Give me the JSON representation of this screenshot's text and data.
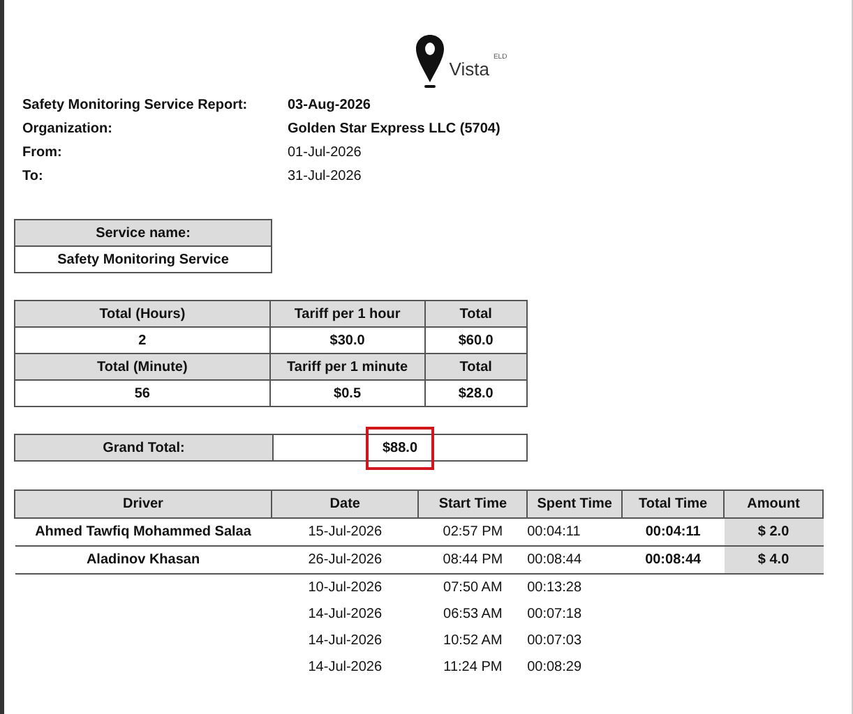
{
  "logo": {
    "text": "Vista",
    "superscript": "ELD"
  },
  "info": [
    {
      "label": "Safety Monitoring Service Report:",
      "value": "03-Aug-2026",
      "bold": true
    },
    {
      "label": "Organization:",
      "value": "Golden Star Express LLC (5704)",
      "bold": true
    },
    {
      "label": "From:",
      "value": "01-Jul-2026",
      "bold": false
    },
    {
      "label": "To:",
      "value": "31-Jul-2026",
      "bold": false
    }
  ],
  "service": {
    "heading": "Service name:",
    "name": "Safety Monitoring Service"
  },
  "tariffs": [
    {
      "columns": [
        "Total (Hours)",
        "Tariff per 1 hour",
        "Total"
      ],
      "values": [
        "2",
        "$30.0",
        "$60.0"
      ]
    },
    {
      "columns": [
        "Total (Minute)",
        "Tariff per 1 minute",
        "Total"
      ],
      "values": [
        "56",
        "$0.5",
        "$28.0"
      ]
    }
  ],
  "grand_total": {
    "label": "Grand Total:",
    "value": "$88.0",
    "highlighted": true
  },
  "drivers_table": {
    "columns": [
      "Driver",
      "Date",
      "Start Time",
      "Spent Time",
      "Total Time",
      "Amount"
    ],
    "drivers": [
      {
        "name": "Ahmed Tawfiq Mohammed Salaa",
        "total_time": "00:04:11",
        "amount": "$ 2.0",
        "trips": [
          {
            "date": "15-Jul-2026",
            "start": "02:57 PM",
            "spent": "00:04:11"
          }
        ]
      },
      {
        "name": "Aladinov Khasan",
        "total_time": "00:08:44",
        "amount": "$ 4.0",
        "trips": [
          {
            "date": "26-Jul-2026",
            "start": "08:44 PM",
            "spent": "00:08:44"
          },
          {
            "date": "10-Jul-2026",
            "start": "07:50 AM",
            "spent": "00:13:28"
          },
          {
            "date": "14-Jul-2026",
            "start": "06:53 AM",
            "spent": "00:07:18"
          },
          {
            "date": "14-Jul-2026",
            "start": "10:52 AM",
            "spent": "00:07:03"
          },
          {
            "date": "14-Jul-2026",
            "start": "11:24 PM",
            "spent": "00:08:29"
          }
        ]
      }
    ]
  }
}
